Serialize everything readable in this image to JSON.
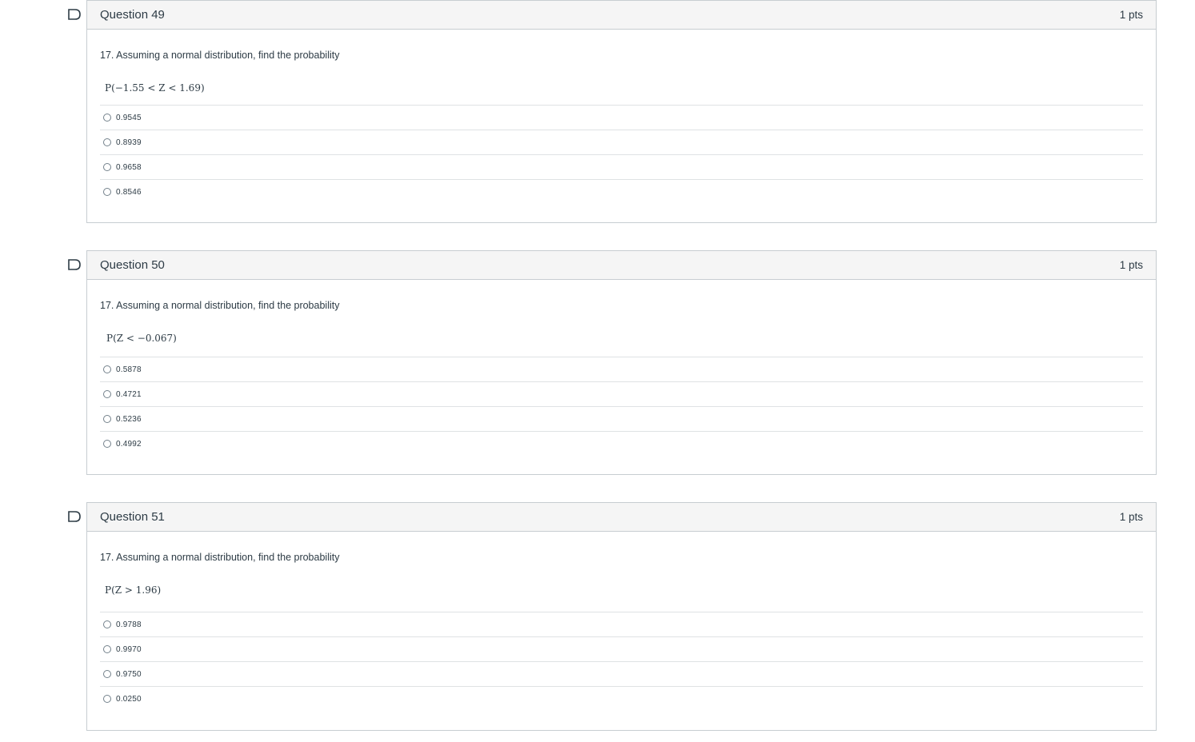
{
  "questions": [
    {
      "title": "Question 49",
      "points": "1 pts",
      "text": "17. Assuming a normal distribution, find the probability",
      "formula": "P(−1.55 < Z < 1.69)",
      "answers": [
        "0.9545",
        "0.8939",
        "0.9658",
        "0.8546"
      ]
    },
    {
      "title": "Question 50",
      "points": "1 pts",
      "text": "17. Assuming a normal distribution, find the probability",
      "formula": "P(Z < −0.067)",
      "answers": [
        "0.5878",
        "0.4721",
        "0.5236",
        "0.4992"
      ]
    },
    {
      "title": "Question 51",
      "points": "1 pts",
      "text": "17. Assuming a normal distribution, find the probability",
      "formula": "P(Z > 1.96)",
      "answers": [
        "0.9788",
        "0.9970",
        "0.9750",
        "0.0250"
      ]
    }
  ],
  "icons": {
    "flag": "flag-question-icon",
    "radio": "radio-circle-icon"
  },
  "colors": {
    "flag": "#2d3b45",
    "border": "#c7cdd1",
    "header_bg": "#f5f5f5"
  }
}
